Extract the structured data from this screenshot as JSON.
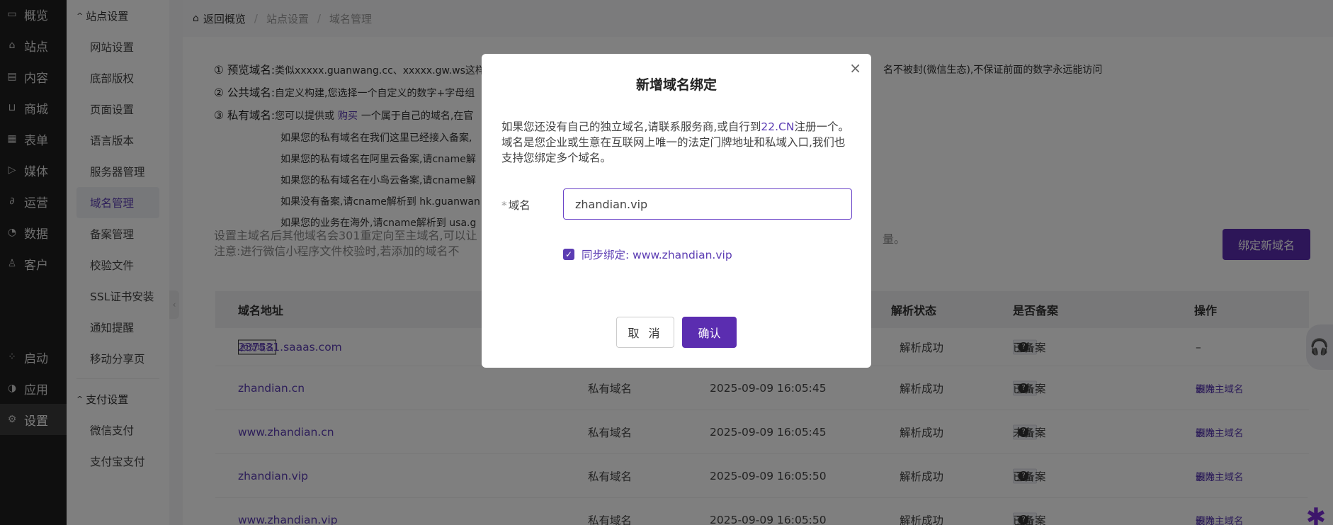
{
  "nav": {
    "items": [
      {
        "label": "概览",
        "icon": "monitor-icon"
      },
      {
        "label": "站点",
        "icon": "home-icon"
      },
      {
        "label": "内容",
        "icon": "document-icon"
      },
      {
        "label": "商城",
        "icon": "cart-icon"
      },
      {
        "label": "表单",
        "icon": "form-icon"
      },
      {
        "label": "媒体",
        "icon": "video-icon"
      },
      {
        "label": "运营",
        "icon": "link-icon"
      },
      {
        "label": "数据",
        "icon": "chart-icon"
      },
      {
        "label": "客户",
        "icon": "user-icon"
      }
    ],
    "lower": [
      {
        "label": "启动",
        "icon": "launch-icon"
      },
      {
        "label": "应用",
        "icon": "apps-icon"
      },
      {
        "label": "设置",
        "icon": "gear-icon"
      }
    ]
  },
  "submenu": {
    "group1": "站点设置",
    "items1": [
      "网站设置",
      "底部版权",
      "页面设置",
      "语言版本",
      "服务器管理",
      "域名管理",
      "备案管理",
      "校验文件",
      "SSL证书安装",
      "通知提醒",
      "移动分享页"
    ],
    "group2": "支付设置",
    "items2": [
      "微信支付",
      "支付宝支付"
    ]
  },
  "breadcrumb": {
    "home": "返回概览",
    "level1": "站点设置",
    "level2": "域名管理"
  },
  "info": {
    "line1_prefix": "① 预览域名:",
    "line1_text": "类似xxxxx.guanwang.cc、xxxxx.gw.ws这样的",
    "line1_tail": "名不被封(微信生态),不保证前面的数字永远能访问",
    "line2_prefix": "② 公共域名:",
    "line2_text": "自定义构建,您选择一个自定义的数字+字母组",
    "line3_prefix": "③ 私有域名:",
    "line3_text_a": "您可以提供或",
    "line3_link": "购买",
    "line3_text_b": "一个属于自己的域名,在官",
    "sub_lines": [
      "如果您的私有域名在我们这里已经接入备案,",
      "如果您的私有域名在阿里云备案,请cname解",
      "如果您的私有域名在小鸟云备案,请cname解",
      "如果没有备案,请cname解析到 hk.guanwan",
      "如果您的业务在海外,请cname解析到 usa.g"
    ]
  },
  "note": {
    "line1": "设置主域名后其他域名会301重定向至主域名,可以让",
    "line2": "注意:进行微信小程序文件校验时,若添加的域名不",
    "tail": "量。"
  },
  "bind_button": "绑定新域名",
  "table": {
    "headers": {
      "domain": "域名地址",
      "status": "解析状态",
      "record": "是否备案",
      "ops": "操作"
    },
    "rows": [
      {
        "tag": "预览域名",
        "domain": "237531.saaas.com",
        "type": "",
        "time": "",
        "status": "解析成功",
        "update": "更新",
        "record": "已备案",
        "ops": [
          "–"
        ]
      },
      {
        "tag": "",
        "domain": "zhandian.cn",
        "type": "私有域名",
        "time": "2025-09-09 16:05:45",
        "status": "解析成功",
        "update": "更新",
        "record": "已备案",
        "ops": [
          "设为主域名",
          "删除"
        ]
      },
      {
        "tag": "",
        "domain": "www.zhandian.cn",
        "type": "私有域名",
        "time": "2025-09-09 16:05:45",
        "status": "解析成功",
        "update": "更新",
        "record": "未备案",
        "ops": [
          "设为主域名",
          "删除"
        ]
      },
      {
        "tag": "",
        "domain": "zhandian.vip",
        "type": "私有域名",
        "time": "2025-09-09 16:05:50",
        "status": "解析成功",
        "update": "更新",
        "record": "已备案",
        "ops": [
          "设为主域名",
          "删除"
        ]
      },
      {
        "tag": "",
        "domain": "www.zhandian.vip",
        "type": "私有域名",
        "time": "2025-09-09 16:05:50",
        "status": "解析成功",
        "update": "更新",
        "record": "已备案",
        "ops": [
          "设为主域名",
          "删除"
        ]
      }
    ]
  },
  "dialog": {
    "title": "新增域名绑定",
    "desc_a": "如果您还没有自己的独立域名,请联系服务商,或自行到",
    "desc_link": "22.CN",
    "desc_b": "注册一个。域名是您企业或生意在互联网上唯一的法定门牌地址和私域入口,我们也支持您绑定多个域名。",
    "field_label": "域名",
    "field_value": "zhandian.vip",
    "sync_label": "同步绑定: www.zhandian.vip",
    "cancel": "取 消",
    "confirm": "确认"
  },
  "colors": {
    "accent": "#5b2db0",
    "nav_bg": "#1e1e1e"
  }
}
